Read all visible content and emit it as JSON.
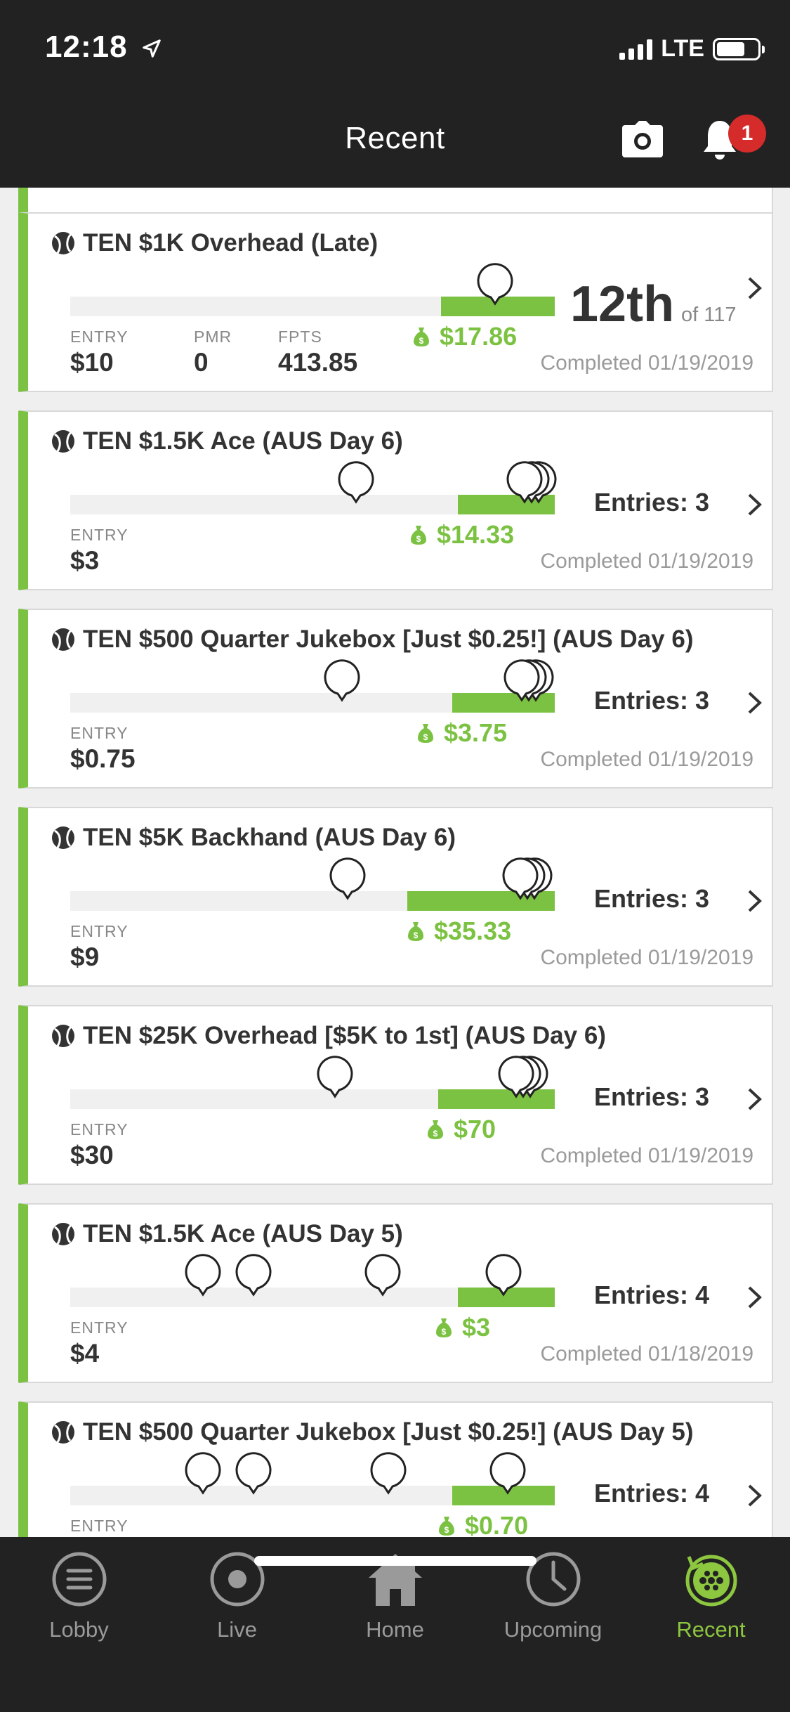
{
  "status": {
    "time": "12:18",
    "network": "LTE"
  },
  "header": {
    "title": "Recent",
    "notifications": "1"
  },
  "colors": {
    "accent": "#7cc242",
    "bar": "#222222",
    "badge": "#d52b2b"
  },
  "labels": {
    "entry": "ENTRY",
    "pmr": "PMR",
    "fpts": "FPTS"
  },
  "contests": [
    {
      "title": "TEN $1K Overhead (Late)",
      "rank": "12th",
      "of": "of 117",
      "prize": "$17.86",
      "entry": "$10",
      "pmr": "0",
      "fpts": "413.85",
      "completed": "Completed 01/19/2019",
      "fill": 0.15
    },
    {
      "title": "TEN $1.5K Ace (AUS Day 6)",
      "entries": "Entries: 3",
      "prize": "$14.33",
      "entry": "$3",
      "completed": "Completed 01/19/2019",
      "fill": 0.2
    },
    {
      "title": "TEN $500 Quarter Jukebox [Just $0.25!] (AUS Day 6)",
      "entries": "Entries: 3",
      "prize": "$3.75",
      "entry": "$0.75",
      "completed": "Completed 01/19/2019",
      "fill": 0.2
    },
    {
      "title": "TEN $5K Backhand (AUS Day 6)",
      "entries": "Entries: 3",
      "prize": "$35.33",
      "entry": "$9",
      "completed": "Completed 01/19/2019",
      "fill": 0.31
    },
    {
      "title": "TEN $25K Overhead [$5K to 1st] (AUS Day 6)",
      "entries": "Entries: 3",
      "prize": "$70",
      "entry": "$30",
      "completed": "Completed 01/19/2019",
      "fill": 0.24
    },
    {
      "title": "TEN $1.5K Ace (AUS Day 5)",
      "entries": "Entries: 4",
      "prize": "$3",
      "entry": "$4",
      "completed": "Completed 01/18/2019",
      "fill": 0.2
    },
    {
      "title": "TEN $500 Quarter Jukebox [Just $0.25!] (AUS Day 5)",
      "entries": "Entries: 4",
      "prize": "$0.70",
      "fill": 0.21
    }
  ],
  "tabs": [
    {
      "label": "Lobby",
      "icon": "lobby-icon"
    },
    {
      "label": "Live",
      "icon": "live-icon"
    },
    {
      "label": "Home",
      "icon": "home-icon"
    },
    {
      "label": "Upcoming",
      "icon": "clock-icon"
    },
    {
      "label": "Recent",
      "icon": "recent-icon",
      "active": true
    }
  ]
}
